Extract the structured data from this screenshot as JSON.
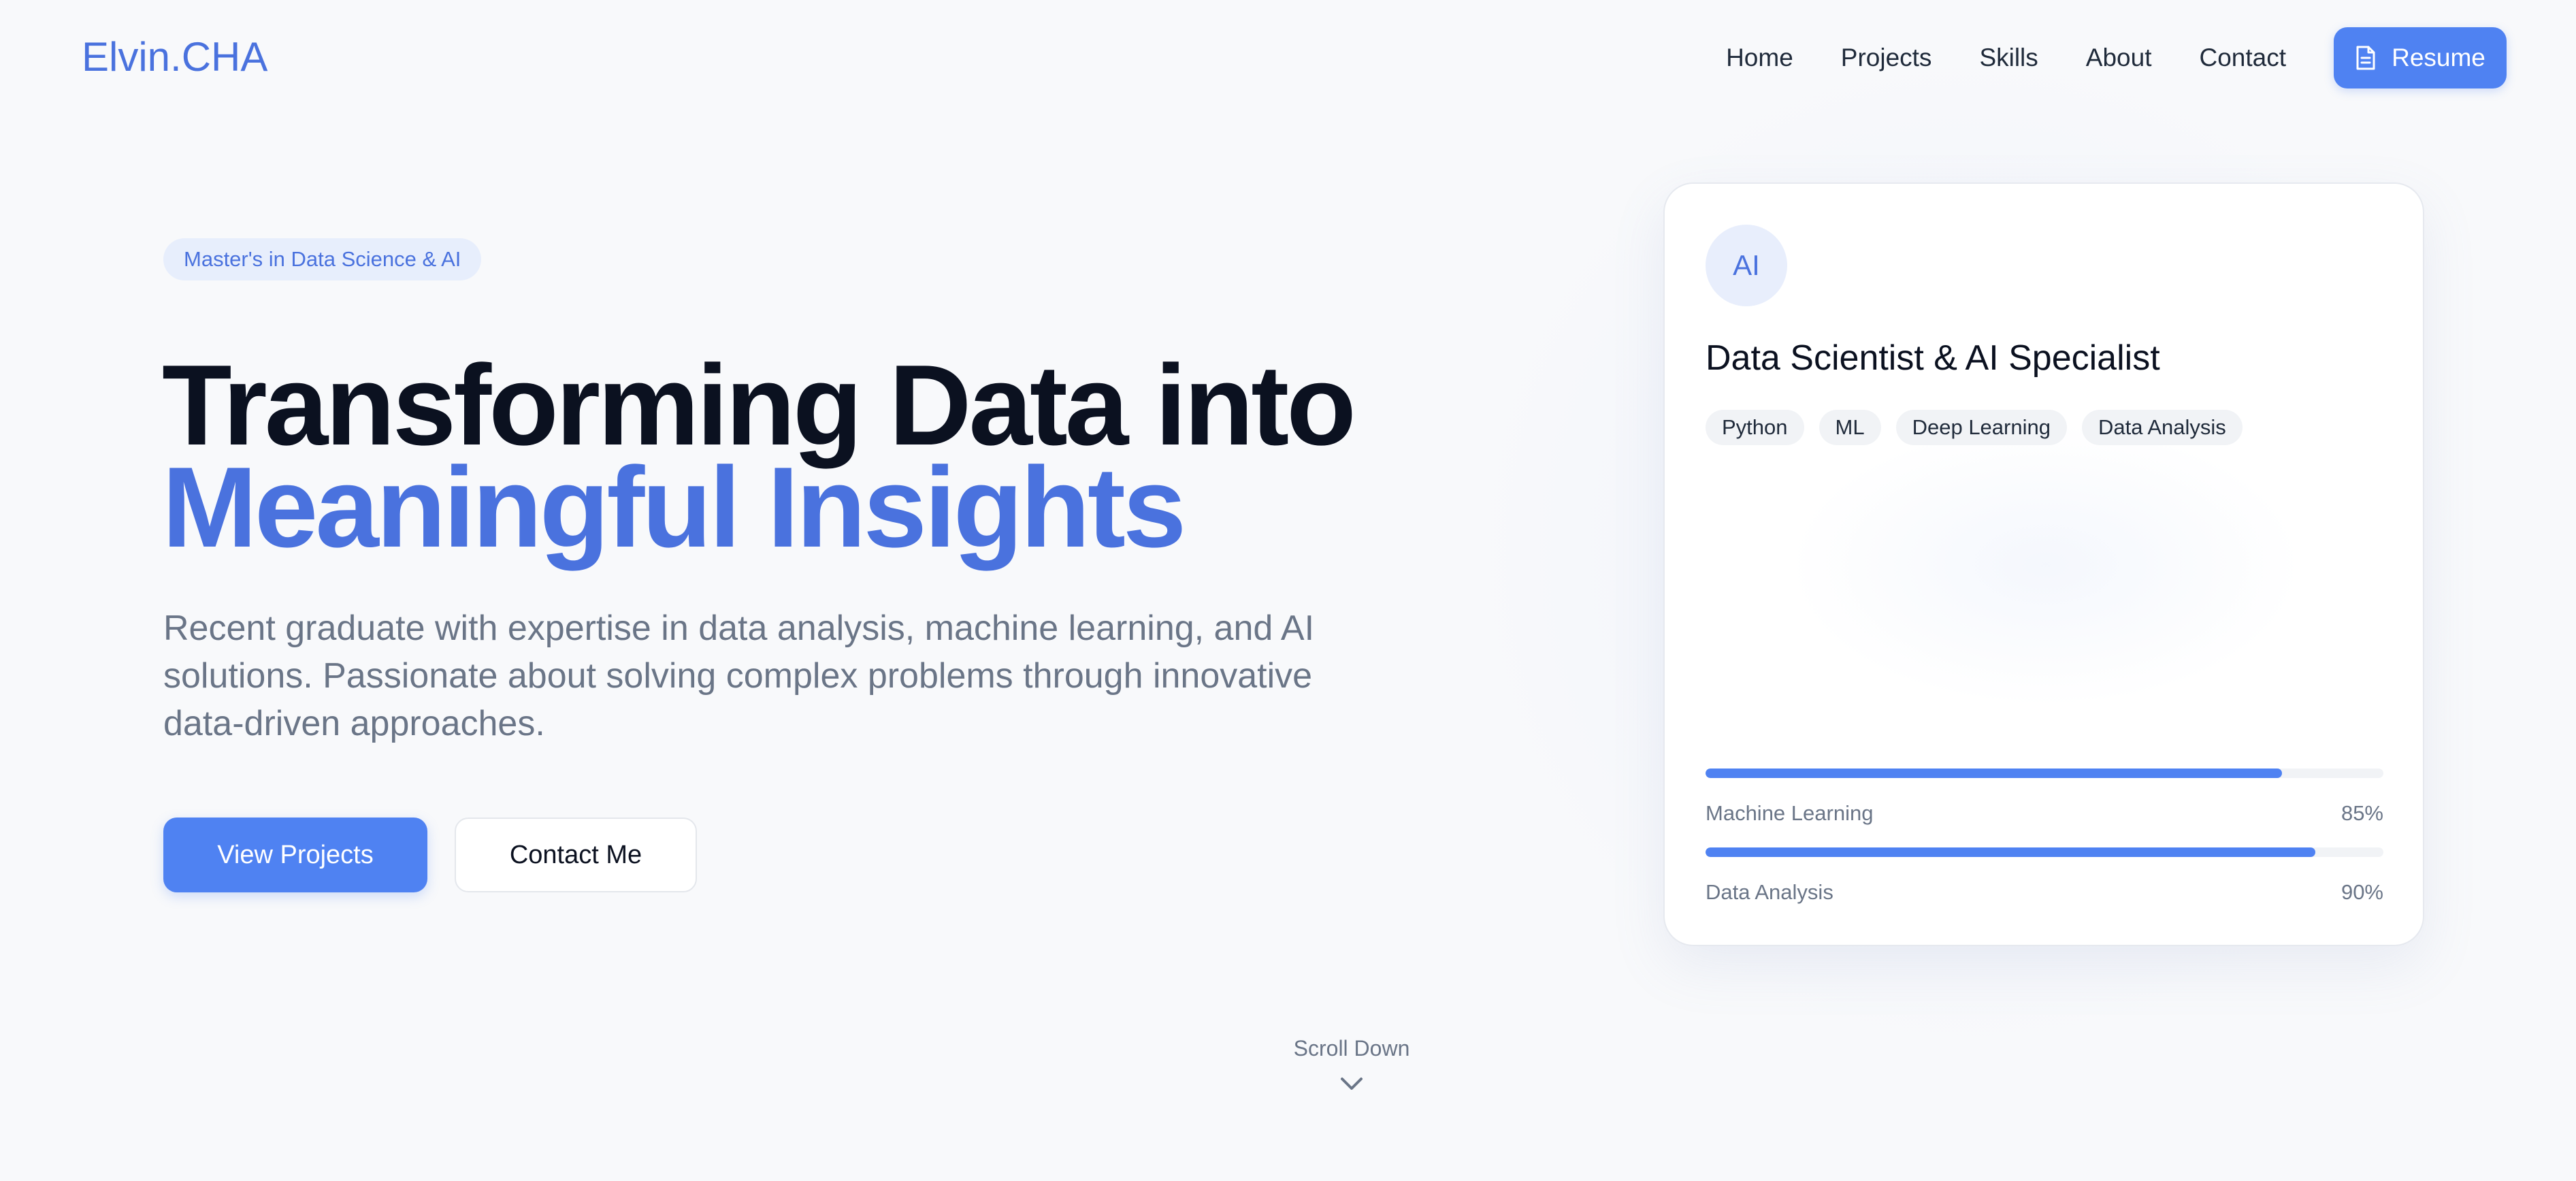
{
  "nav": {
    "logo": "Elvin.CHA",
    "links": [
      "Home",
      "Projects",
      "Skills",
      "About",
      "Contact"
    ],
    "resume_label": "Resume",
    "resume_icon": "document-icon"
  },
  "hero": {
    "badge": "Master's in Data Science & AI",
    "headline_line1": "Transforming Data into",
    "headline_line2": "Meaningful Insights",
    "description": "Recent graduate with expertise in data analysis, machine learning, and AI solutions. Passionate about solving complex problems through innovative data-driven approaches.",
    "primary_button": "View Projects",
    "secondary_button": "Contact Me"
  },
  "card": {
    "avatar": "AI",
    "title": "Data Scientist & AI Specialist",
    "tags": [
      "Python",
      "ML",
      "Deep Learning",
      "Data Analysis"
    ],
    "skills": [
      {
        "name": "Machine Learning",
        "percent_label": "85%",
        "value": 0.85
      },
      {
        "name": "Data Analysis",
        "percent_label": "90%",
        "value": 0.9
      }
    ]
  },
  "scroll": {
    "label": "Scroll Down",
    "icon": "chevron-down-icon"
  },
  "colors": {
    "accent": "#4f82f2",
    "brand": "#4a72de",
    "heading": "#0b1120",
    "muted": "#6a7587",
    "background": "#f8f9fb"
  }
}
